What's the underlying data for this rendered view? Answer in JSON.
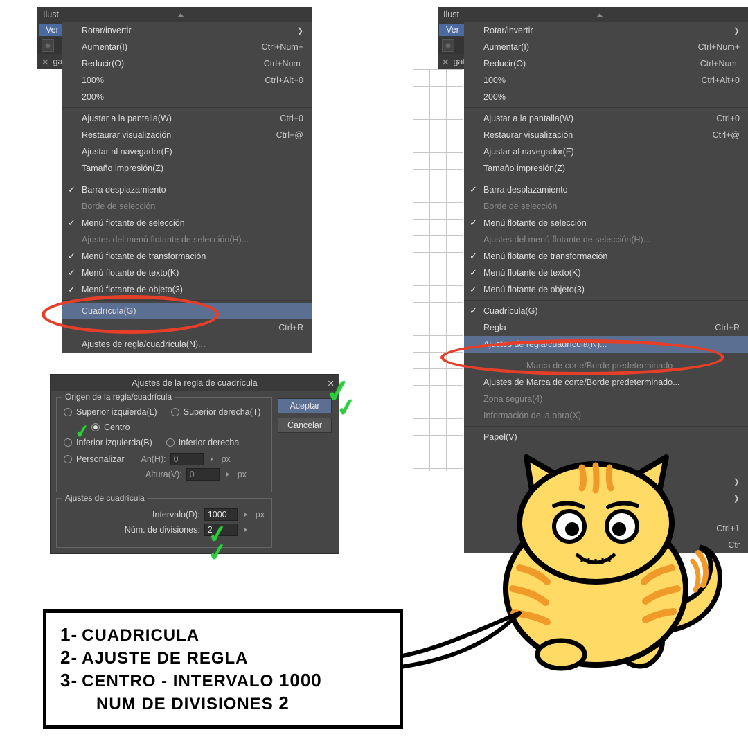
{
  "left_panel": {
    "title": "Ilust",
    "tab": "Ver",
    "file_tab": "gatit"
  },
  "right_panel": {
    "title": "Ilust",
    "tab": "Ver",
    "file_tab": "gatit"
  },
  "menu": {
    "rotar": "Rotar/invertir",
    "aumentar": "Aumentar(I)",
    "aumentar_sc": "Ctrl+Num+",
    "reducir": "Reducir(O)",
    "reducir_sc": "Ctrl+Num-",
    "cien": "100%",
    "cien_sc": "Ctrl+Alt+0",
    "doscien": "200%",
    "ajustar_pantalla": "Ajustar a la pantalla(W)",
    "ajustar_pantalla_sc": "Ctrl+0",
    "restaurar": "Restaurar visualización",
    "restaurar_sc": "Ctrl+@",
    "ajustar_nav": "Ajustar al navegador(F)",
    "tam_impresion": "Tamaño impresión(Z)",
    "barra_desp": "Barra desplazamiento",
    "borde_sel": "Borde de selección",
    "menu_flot_sel": "Menú flotante de selección",
    "ajustes_menu_flot": "Ajustes del menú flotante de selección(H)...",
    "menu_flot_trans": "Menú flotante de transformación",
    "menu_flot_texto": "Menú flotante de texto(K)",
    "menu_flot_obj_left": "Menú flotante de objeto(3)",
    "menu_flot_obj_right": "Menú flotante de objeto(3)",
    "cuadricula": "Cuadrícula(G)",
    "regla": "Regla",
    "regla_sc": "Ctrl+R",
    "ajustes_regla": "Ajustes de regla/cuadrícula(N)...",
    "marca_corte_partial": "Marca de corte/Borde predeterminado",
    "ajustes_marca": "Ajustes de Marca de corte/Borde predeterminado...",
    "zona_segura": "Zona segura(4)",
    "info_obra": "Información de la obra(X)",
    "panel_partial": "Papel(V)",
    "sc_ctrl1": "Ctrl+1",
    "sc_ctr": "Ctr"
  },
  "dialog": {
    "title": "Ajustes de la regla de cuadrícula",
    "groupbox1": "Origen de la regla/cuadrícula",
    "sup_izq": "Superior izquierda(L)",
    "sup_der": "Superior derecha(T)",
    "centro": "Centro",
    "inf_izq": "Inferior izquierda(B)",
    "inf_der": "Inferior derecha",
    "personalizar": "Personalizar",
    "an": "An(H):",
    "altura": "Altura(V):",
    "cero": "0",
    "px": "px",
    "groupbox2": "Ajustes de cuadrícula",
    "intervalo": "Intervalo(D):",
    "intervalo_val": "1000",
    "num_div": "Núm. de divisiones:",
    "num_div_val": "2",
    "aceptar": "Aceptar",
    "cancelar": "Cancelar"
  },
  "instructions": {
    "n1": "1-",
    "l1": "CUADRICULA",
    "n2": "2-",
    "l2": "AJUSTE DE REGLA",
    "n3": "3-",
    "l3a": "CENTRO - INTERVALO",
    "l3a_b": "1000",
    "l3b": "NUM DE DIVISIONES",
    "l3b_b": "2"
  }
}
